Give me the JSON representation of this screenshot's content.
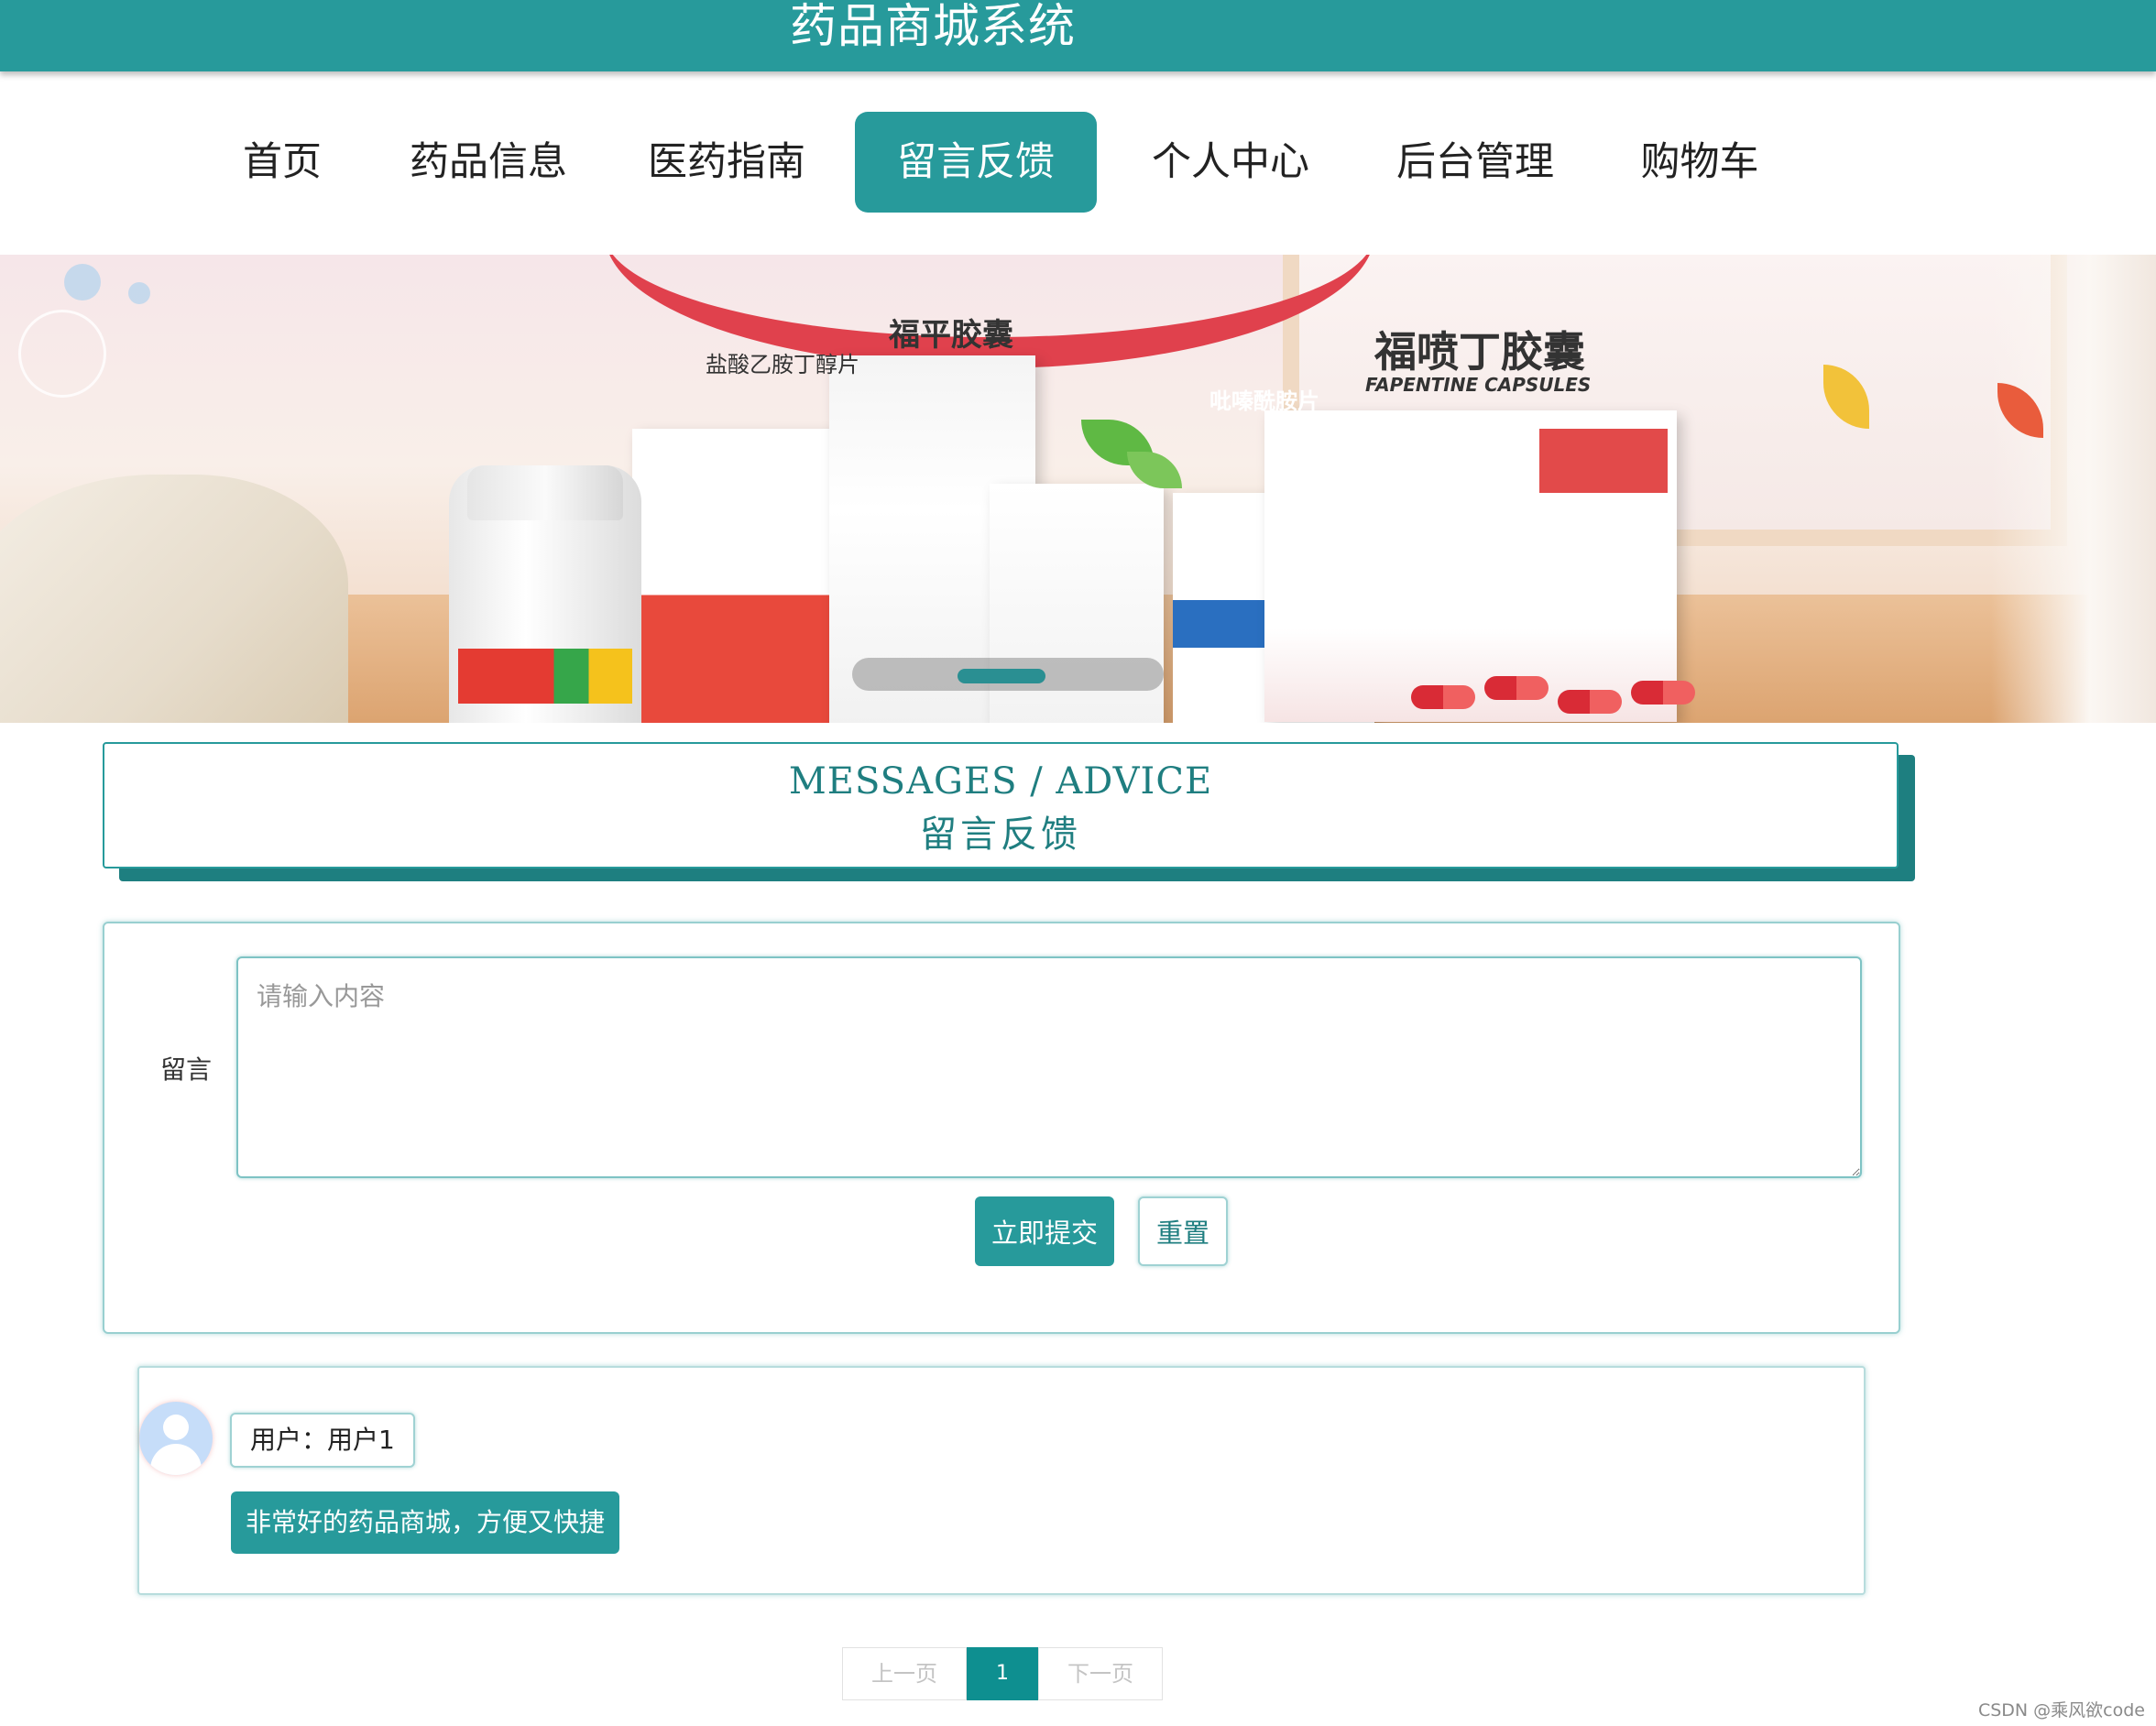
{
  "header": {
    "site_title": "药品商城系统"
  },
  "nav": {
    "items": [
      {
        "label": "首页",
        "active": false
      },
      {
        "label": "药品信息",
        "active": false
      },
      {
        "label": "医药指南",
        "active": false
      },
      {
        "label": "留言反馈",
        "active": true
      },
      {
        "label": "个人中心",
        "active": false
      },
      {
        "label": "后台管理",
        "active": false
      },
      {
        "label": "购物车",
        "active": false
      }
    ]
  },
  "banner": {
    "carousel_current": 1
  },
  "section": {
    "title_en": "MESSAGES / ADVICE",
    "title_zh": "留言反馈"
  },
  "form": {
    "label": "留言",
    "placeholder": "请输入内容",
    "value": "",
    "submit_label": "立即提交",
    "reset_label": "重置"
  },
  "messages": [
    {
      "user": "用户：用户1",
      "content": "非常好的药品商城，方便又快捷"
    }
  ],
  "pagination": {
    "prev_label": "上一页",
    "current_page": "1",
    "next_label": "下一页"
  },
  "watermark": "CSDN @乘风欲code",
  "colors": {
    "primary": "#279a9b",
    "primary_dark": "#1e7f80",
    "text": "#222222"
  }
}
